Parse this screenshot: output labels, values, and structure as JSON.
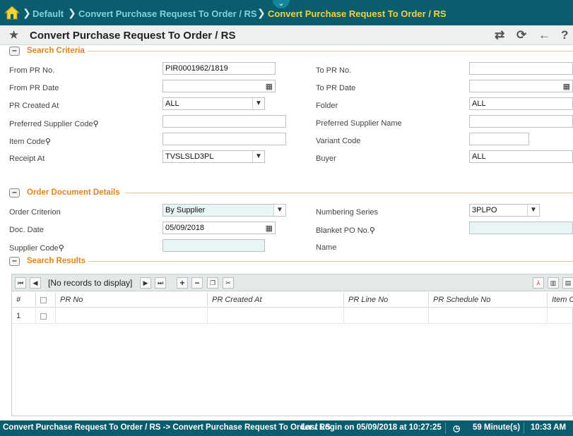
{
  "breadcrumb": {
    "items": [
      "Default",
      "Convert Purchase Request To Order / RS",
      "Convert Purchase Request To Order / RS"
    ],
    "collapse_glyph": "⌄"
  },
  "page": {
    "title": "Convert Purchase Request To Order / RS"
  },
  "search_criteria": {
    "title": "Search Criteria",
    "from_pr_no": {
      "label": "From PR No.",
      "value": "PIR0001962/1819"
    },
    "to_pr_no": {
      "label": "To PR No.",
      "value": ""
    },
    "from_pr_date": {
      "label": "From PR Date",
      "value": ""
    },
    "to_pr_date": {
      "label": "To PR Date",
      "value": ""
    },
    "pr_created_at": {
      "label": "PR Created At",
      "value": "ALL"
    },
    "folder": {
      "label": "Folder",
      "value": "ALL"
    },
    "preferred_supplier_code": {
      "label": "Preferred Supplier Code",
      "value": ""
    },
    "preferred_supplier_name": {
      "label": "Preferred Supplier Name",
      "value": ""
    },
    "item_code": {
      "label": "Item Code",
      "value": ""
    },
    "variant_code": {
      "label": "Variant Code",
      "value": ""
    },
    "receipt_at": {
      "label": "Receipt At",
      "value": "TVSLSLD3PL"
    },
    "buyer": {
      "label": "Buyer",
      "value": "ALL"
    }
  },
  "order_document": {
    "title": "Order Document Details",
    "order_criterion": {
      "label": "Order Criterion",
      "value": "By Supplier"
    },
    "numbering_series": {
      "label": "Numbering Series",
      "value": "3PLPO"
    },
    "doc_date": {
      "label": "Doc. Date",
      "value": "05/09/2018"
    },
    "blanket_po_no": {
      "label": "Blanket PO No.",
      "value": ""
    },
    "supplier_code": {
      "label": "Supplier Code",
      "value": ""
    },
    "name": {
      "label": "Name",
      "value": ""
    }
  },
  "search_results": {
    "title": "Search Results",
    "message": "[No records to display]",
    "columns": [
      "#",
      "",
      "PR No",
      "PR Created At",
      "PR Line No",
      "PR Schedule No",
      "Item C"
    ],
    "rows": [
      {
        "num": "1"
      }
    ]
  },
  "footer": {
    "path": "Convert Purchase Request To Order / RS -> Convert Purchase Request To Order / RS",
    "last_login": "Last Login on 05/09/2018 at 10:27:25",
    "session": "59 Minute(s)",
    "time": "10:33 AM"
  },
  "colors": {
    "topbar": "#0a5d6e",
    "section_title": "#e5841d",
    "active_crumb": "#f3d23a"
  }
}
